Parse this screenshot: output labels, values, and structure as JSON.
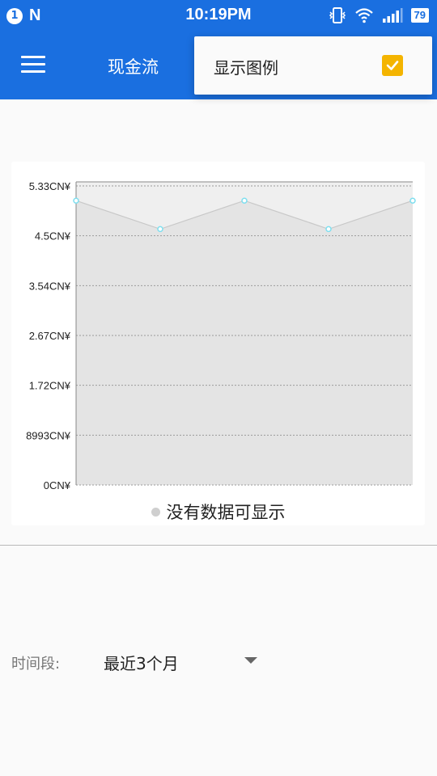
{
  "status_bar": {
    "notification_count": "1",
    "n_logo": "N",
    "time": "10:19PM",
    "battery": "79",
    "icons": [
      "vibrate-icon",
      "wifi-icon",
      "signal-icon",
      "battery-icon"
    ]
  },
  "app_bar": {
    "title": "现金流",
    "menu_icon": "hamburger-menu-icon",
    "background_color": "#1a6fe0"
  },
  "popup_menu": {
    "item_label": "显示图例",
    "item_checked": true,
    "check_color": "#f4b400"
  },
  "chart_data": {
    "type": "area",
    "y_tick_labels": [
      "5.33CN¥",
      "4.5CN¥",
      "3.54CN¥",
      "2.67CN¥",
      "1.72CN¥",
      "8993CN¥",
      "0CN¥"
    ],
    "points": [
      5.0,
      4.5,
      5.0,
      4.5,
      5.0
    ],
    "ylim": [
      0,
      5.33
    ],
    "grid": true,
    "legend_text": "没有数据可显示",
    "legend_dot_color": "#cfcfcf",
    "area_color": "#e4e4e4",
    "marker_color": "#7fdfef"
  },
  "period": {
    "label": "时间段:",
    "value": "最近3个月"
  }
}
